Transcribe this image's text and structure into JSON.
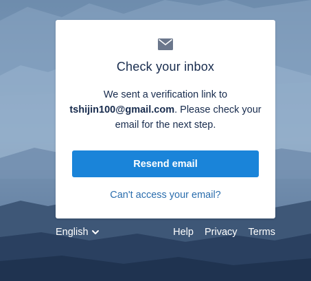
{
  "card": {
    "icon": "mail-icon",
    "title": "Check your inbox",
    "message_prefix": "We sent a verification link to",
    "email": "tshijin100@gmail.com",
    "message_suffix": ". Please check your email for the next step.",
    "resend_label": "Resend email",
    "cant_access_label": "Can't access your email?"
  },
  "footer": {
    "language": "English",
    "links": [
      "Help",
      "Privacy",
      "Terms"
    ]
  },
  "colors": {
    "button": "#1a84d9",
    "link": "#2a6dad",
    "text": "#172b4d"
  }
}
